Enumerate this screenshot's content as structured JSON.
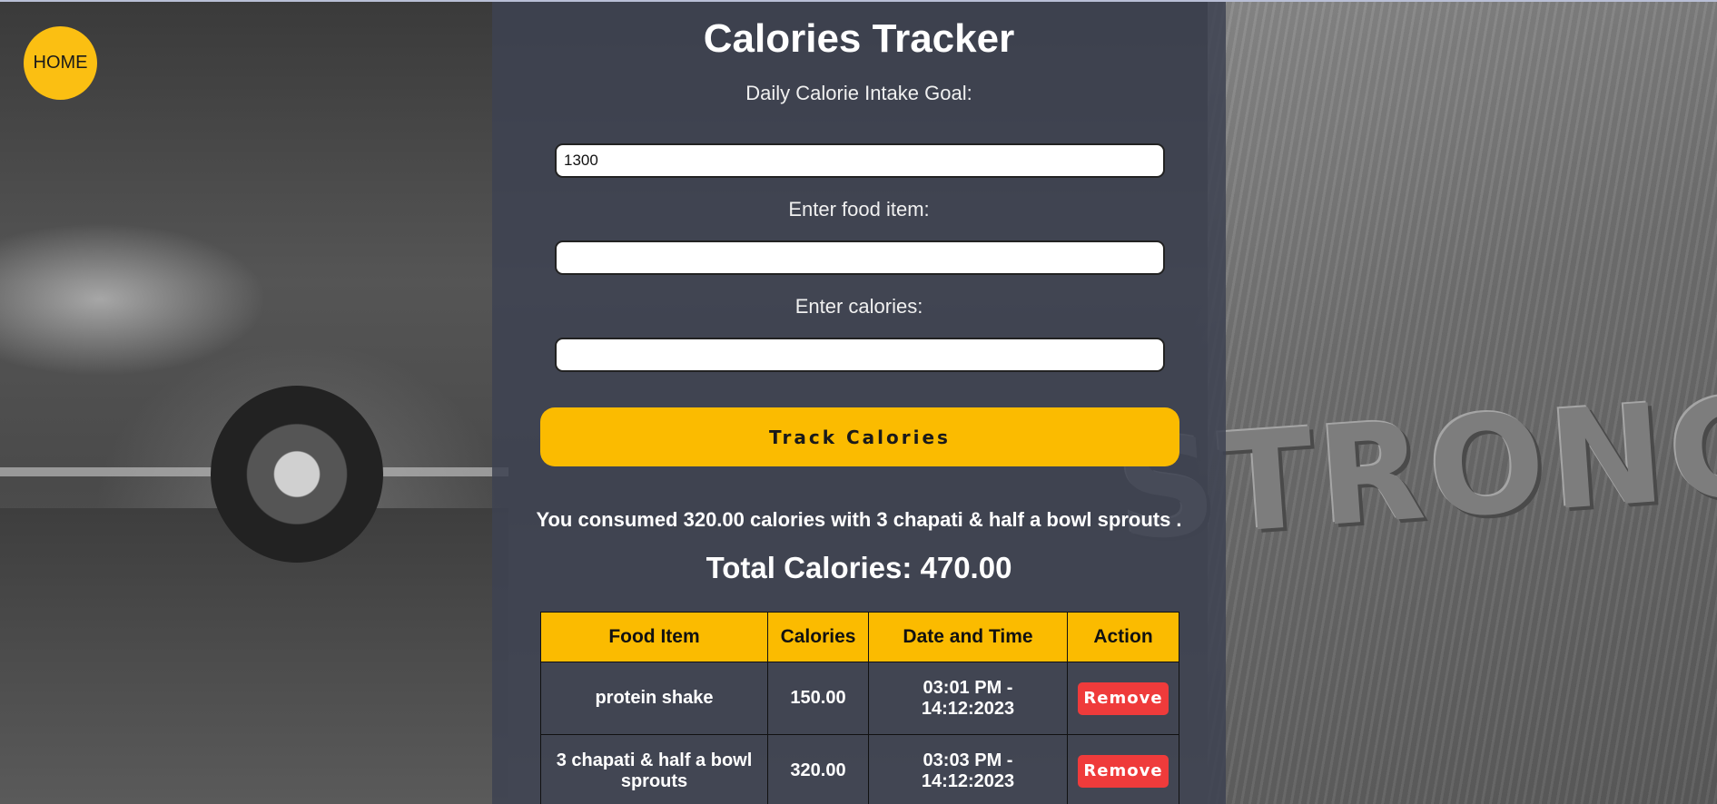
{
  "nav": {
    "home_label": "HOME"
  },
  "tracker": {
    "title": "Calories Tracker",
    "goal_label": "Daily Calorie Intake Goal:",
    "goal_value": "1300",
    "food_label": "Enter food item:",
    "food_value": "",
    "calories_label": "Enter calories:",
    "calories_value": "",
    "track_button": "Track Calories",
    "consumed_message": "You consumed 320.00 calories with 3 chapati & half a bowl sprouts .",
    "total_calories": "Total Calories: 470.00"
  },
  "table": {
    "headers": [
      "Food Item",
      "Calories",
      "Date and Time",
      "Action"
    ],
    "rows": [
      {
        "food": "protein shake",
        "calories": "150.00",
        "time": "03:01 PM -",
        "date": "14:12:2023",
        "action": "Remove"
      },
      {
        "food": "3 chapati & half a bowl sprouts",
        "calories": "320.00",
        "time": "03:03 PM -",
        "date": "14:12:2023",
        "action": "Remove"
      }
    ]
  },
  "colors": {
    "accent": "#fbbb00",
    "danger": "#ef3b3b",
    "panel": "#3e4252"
  },
  "background": {
    "sign_text": "STRONG"
  }
}
